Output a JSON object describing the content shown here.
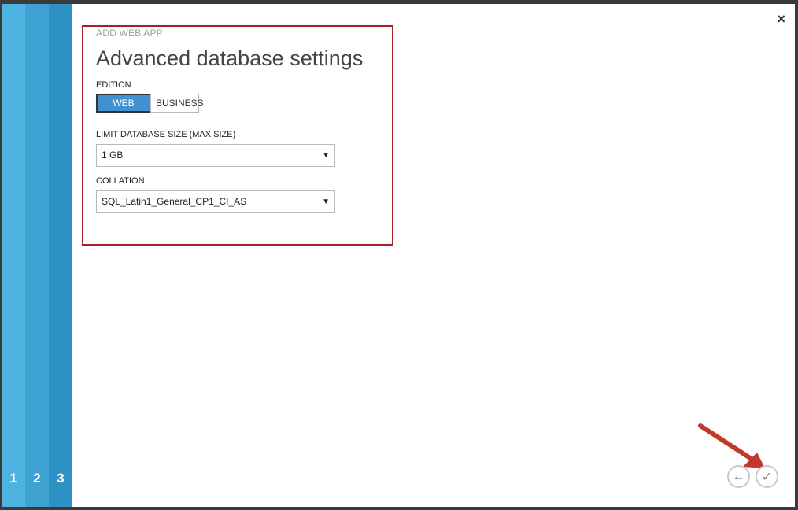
{
  "steps": [
    {
      "label": "1"
    },
    {
      "label": "2"
    },
    {
      "label": "3"
    }
  ],
  "close_label": "×",
  "breadcrumb": "ADD WEB APP",
  "title": "Advanced database settings",
  "edition": {
    "label": "EDITION",
    "options": [
      "WEB",
      "BUSINESS"
    ],
    "selected": "WEB"
  },
  "size": {
    "label": "LIMIT DATABASE SIZE (MAX SIZE)",
    "value": "1 GB"
  },
  "collation": {
    "label": "COLLATION",
    "value": "SQL_Latin1_General_CP1_CI_AS"
  },
  "nav": {
    "back_icon": "←",
    "finish_icon": "✓"
  },
  "colors": {
    "highlight": "#a8202a",
    "accent": "#4292d3",
    "annotation_arrow": "#c0392b"
  }
}
